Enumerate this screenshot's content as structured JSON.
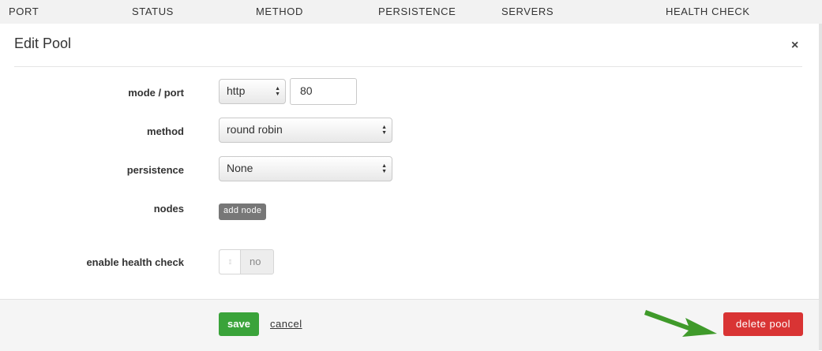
{
  "table_header": {
    "columns": [
      "PORT",
      "STATUS",
      "METHOD",
      "PERSISTENCE",
      "SERVERS",
      "HEALTH CHECK"
    ]
  },
  "modal": {
    "title": "Edit Pool",
    "close_label": "×",
    "fields": {
      "mode_port": {
        "label": "mode / port",
        "mode_value": "http",
        "port_value": "80"
      },
      "method": {
        "label": "method",
        "value": "round robin"
      },
      "persistence": {
        "label": "persistence",
        "value": "None"
      },
      "nodes": {
        "label": "nodes",
        "add_button": "add node"
      },
      "health_check": {
        "label": "enable health check",
        "toggle_state": "no",
        "enabled": false
      }
    },
    "footer": {
      "save": "save",
      "cancel": "cancel",
      "delete": "delete pool"
    }
  },
  "colors": {
    "save": "#3aa33a",
    "delete": "#d93434",
    "annotation_arrow": "#3f9a2a",
    "add_node": "#777777"
  },
  "icons": {
    "close": "close-icon",
    "select_arrows": "select-arrows-icon",
    "toggle_grip": "grip-icon",
    "annotation": "arrow-annotation-icon"
  }
}
